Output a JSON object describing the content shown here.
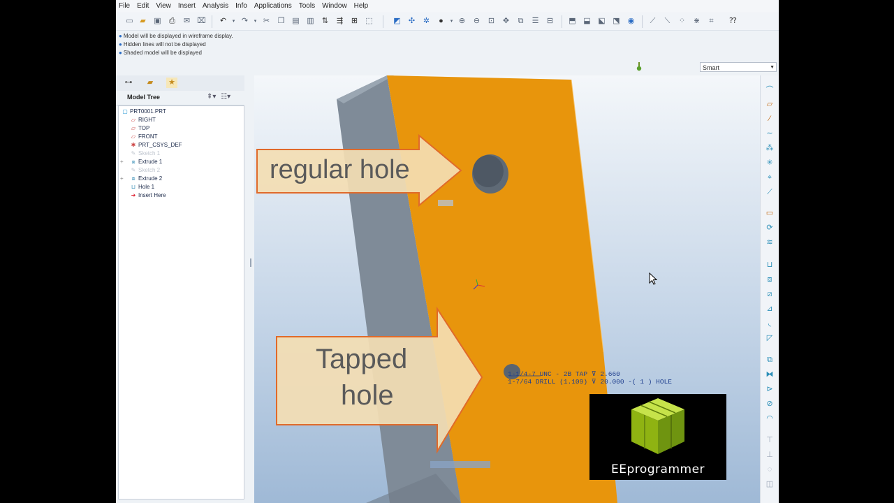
{
  "menu": [
    "File",
    "Edit",
    "View",
    "Insert",
    "Analysis",
    "Info",
    "Applications",
    "Tools",
    "Window",
    "Help"
  ],
  "messages": [
    "Model will be displayed in wireframe display.",
    "Hidden lines will not be displayed",
    "Shaded model will be displayed"
  ],
  "filter": {
    "value": "Smart"
  },
  "model_tree": {
    "title": "Model Tree",
    "items": [
      {
        "label": "PRT0001.PRT",
        "icon": "part-icon",
        "dim": false
      },
      {
        "label": "RIGHT",
        "icon": "datum-plane-icon",
        "dim": false
      },
      {
        "label": "TOP",
        "icon": "datum-plane-icon",
        "dim": false
      },
      {
        "label": "FRONT",
        "icon": "datum-plane-icon",
        "dim": false
      },
      {
        "label": "PRT_CSYS_DEF",
        "icon": "csys-icon",
        "dim": false
      },
      {
        "label": "Sketch 1",
        "icon": "sketch-icon",
        "dim": true
      },
      {
        "label": "Extrude 1",
        "icon": "extrude-icon",
        "dim": false
      },
      {
        "label": "Sketch 2",
        "icon": "sketch-icon",
        "dim": true
      },
      {
        "label": "Extrude 2",
        "icon": "extrude-icon",
        "dim": false
      },
      {
        "label": "Hole 1",
        "icon": "hole-icon",
        "dim": false
      },
      {
        "label": "Insert Here",
        "icon": "insert-here-icon",
        "dim": false
      }
    ]
  },
  "overlay": {
    "regular_hole": "regular hole",
    "tapped_line1": "Tapped",
    "tapped_line2": "hole"
  },
  "annotation": {
    "line1": "1-1/4-7 UNC - 2B TAP ⊽ 2.660",
    "line2": "1-7/64 DRILL (1.109) ⊽ 20.000 -( 1 ) HOLE"
  },
  "logo": {
    "text": "EEprogrammer"
  },
  "colors": {
    "part": "#e8950c",
    "side": "#7d8a98",
    "arrow_fill": "#f3ddb3",
    "arrow_stroke": "#e06a2a",
    "logo_cube": "#9cc317"
  }
}
